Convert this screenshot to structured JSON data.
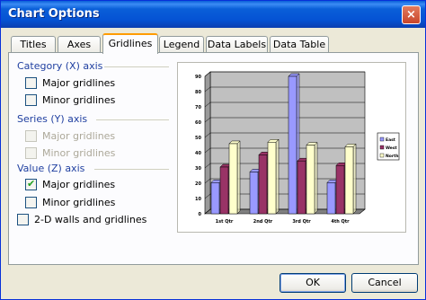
{
  "window": {
    "title": "Chart Options",
    "close_glyph": "×"
  },
  "tabs": [
    {
      "label": "Titles",
      "active": false
    },
    {
      "label": "Axes",
      "active": false
    },
    {
      "label": "Gridlines",
      "active": true
    },
    {
      "label": "Legend",
      "active": false
    },
    {
      "label": "Data Labels",
      "active": false
    },
    {
      "label": "Data Table",
      "active": false
    }
  ],
  "groups": {
    "category": {
      "label": "Category (X) axis",
      "major": {
        "label": "Major gridlines",
        "checked": false,
        "enabled": true
      },
      "minor": {
        "label": "Minor gridlines",
        "checked": false,
        "enabled": true
      }
    },
    "series": {
      "label": "Series (Y) axis",
      "major": {
        "label": "Major gridlines",
        "checked": false,
        "enabled": false
      },
      "minor": {
        "label": "Minor gridlines",
        "checked": false,
        "enabled": false
      }
    },
    "value": {
      "label": "Value (Z) axis",
      "major": {
        "label": "Major gridlines",
        "checked": true,
        "enabled": true
      },
      "minor": {
        "label": "Minor gridlines",
        "checked": false,
        "enabled": true
      }
    }
  },
  "walls": {
    "label": "2-D walls and gridlines",
    "checked": false
  },
  "buttons": {
    "ok": "OK",
    "cancel": "Cancel"
  },
  "colors": {
    "east": "#9999ff",
    "west": "#993366",
    "north": "#ffffcc",
    "wall": "#c0c0c0"
  },
  "chart_data": {
    "type": "bar",
    "categories": [
      "1st Qtr",
      "2nd Qtr",
      "3rd Qtr",
      "4th Qtr"
    ],
    "series": [
      {
        "name": "East",
        "values": [
          20.4,
          27.4,
          90,
          20.4
        ]
      },
      {
        "name": "West",
        "values": [
          30.6,
          38.6,
          34.6,
          31.6
        ]
      },
      {
        "name": "North",
        "values": [
          45.9,
          46.9,
          45,
          43.9
        ]
      }
    ],
    "yticks": [
      "0",
      "10",
      "20",
      "30",
      "40",
      "50",
      "60",
      "70",
      "80",
      "90"
    ],
    "ylim": [
      0,
      90
    ],
    "grid": true,
    "legend": "right"
  }
}
